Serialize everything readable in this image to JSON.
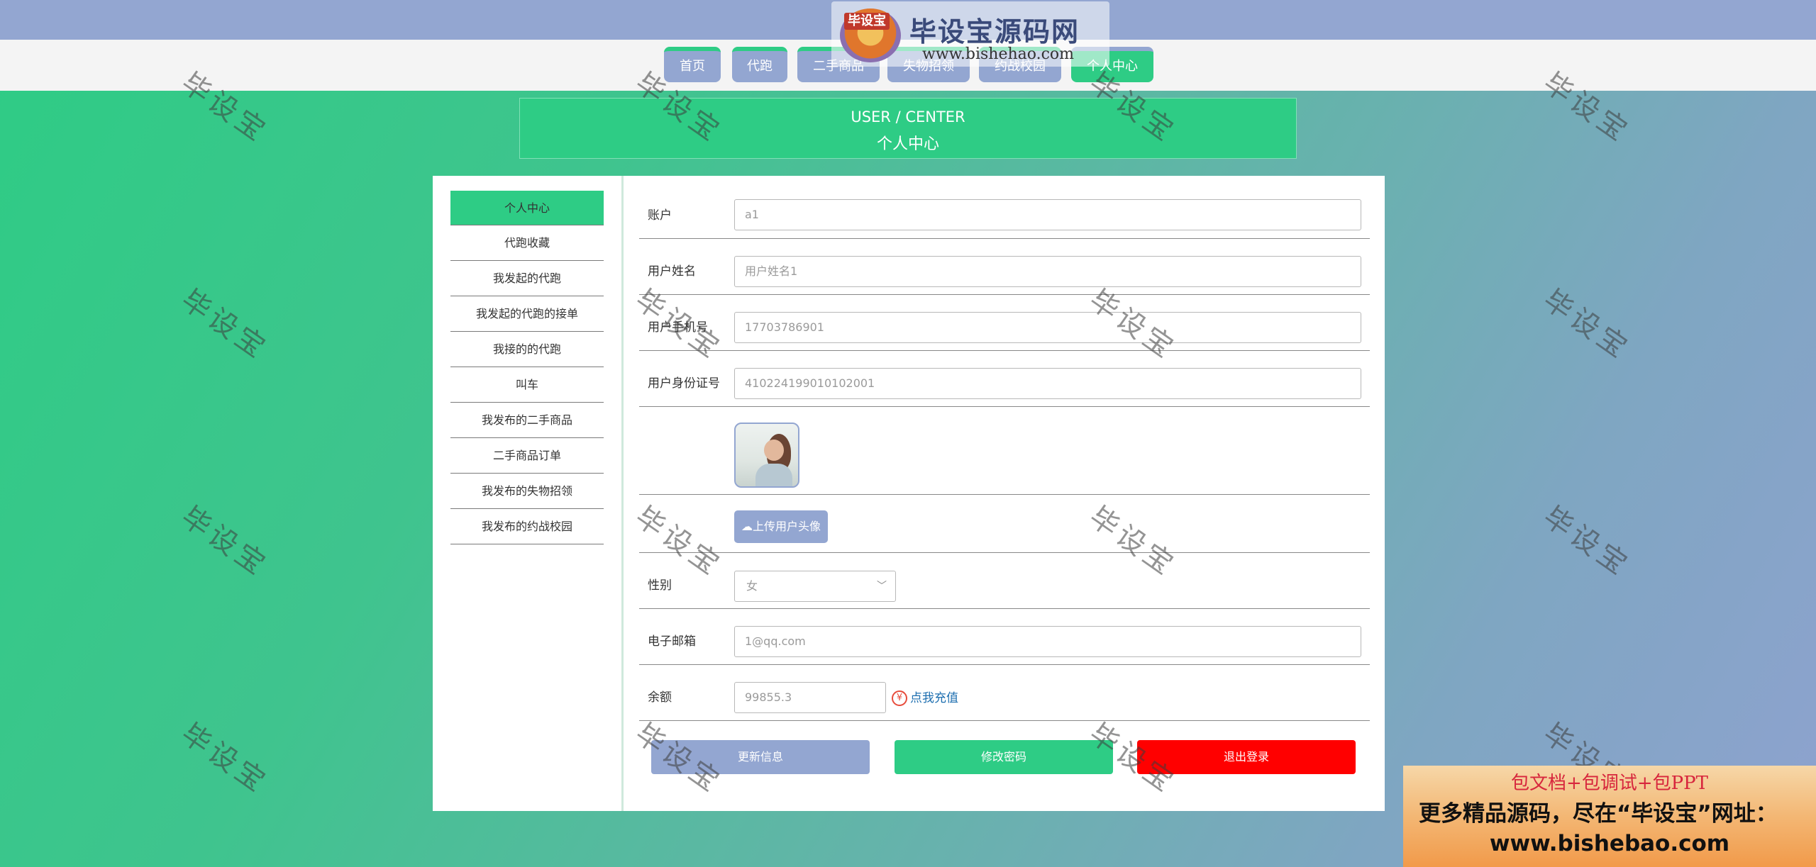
{
  "site_logo": {
    "badge": "毕设宝",
    "title": "毕设宝源码网",
    "url": "www.bishehao.com"
  },
  "nav": {
    "items": [
      {
        "label": "首页",
        "active": false
      },
      {
        "label": "代跑",
        "active": false
      },
      {
        "label": "二手商品",
        "active": false
      },
      {
        "label": "失物招领",
        "active": false
      },
      {
        "label": "约战校园",
        "active": false
      },
      {
        "label": "个人中心",
        "active": true
      }
    ]
  },
  "banner": {
    "en": "USER / CENTER",
    "zh": "个人中心"
  },
  "sidebar": {
    "items": [
      {
        "label": "个人中心",
        "active": true
      },
      {
        "label": "代跑收藏",
        "active": false
      },
      {
        "label": "我发起的代跑",
        "active": false
      },
      {
        "label": "我发起的代跑的接单",
        "active": false
      },
      {
        "label": "我接的的代跑",
        "active": false
      },
      {
        "label": "叫车",
        "active": false
      },
      {
        "label": "我发布的二手商品",
        "active": false
      },
      {
        "label": "二手商品订单",
        "active": false
      },
      {
        "label": "我发布的失物招领",
        "active": false
      },
      {
        "label": "我发布的约战校园",
        "active": false
      }
    ]
  },
  "form": {
    "account": {
      "label": "账户",
      "value": "a1"
    },
    "name": {
      "label": "用户姓名",
      "value": "",
      "placeholder": "用户姓名1"
    },
    "phone": {
      "label": "用户手机号",
      "value": "17703786901"
    },
    "idcard": {
      "label": "用户身份证号",
      "value": "410224199010102001"
    },
    "upload_label": "上传用户头像",
    "gender": {
      "label": "性别",
      "value": "女"
    },
    "email": {
      "label": "电子邮箱",
      "value": "1@qq.com"
    },
    "balance": {
      "label": "余额",
      "value": "99855.3",
      "recharge_label": "点我充值"
    }
  },
  "actions": {
    "update": "更新信息",
    "change_password": "修改密码",
    "logout": "退出登录"
  },
  "watermark_text": "毕设宝",
  "promo": {
    "line1": "包文档+包调试+包PPT",
    "line2": "更多精品源码，尽在“毕设宝”网址：",
    "line3": "www.bishebao.com"
  },
  "colors": {
    "primary_green": "#2ecc85",
    "nav_blue": "#93a6d1",
    "logout_red": "#ff0000"
  }
}
